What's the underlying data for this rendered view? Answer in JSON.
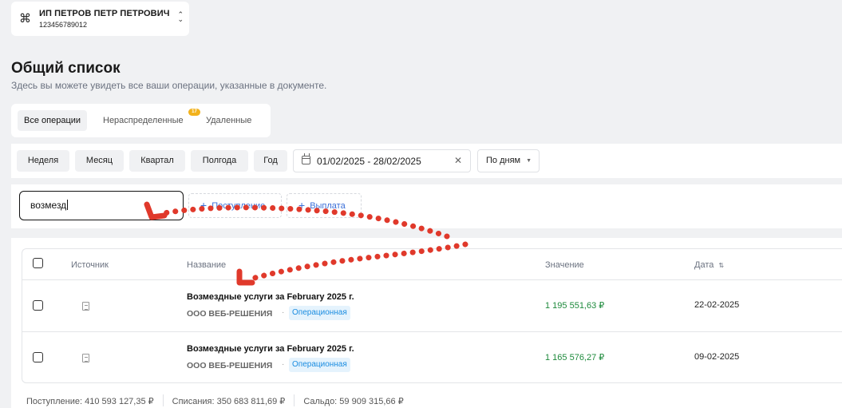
{
  "org": {
    "icon": "command-icon",
    "name": "ИП ПЕТРОВ ПЕТР ПЕТРОВИЧ",
    "inn": "123456789012",
    "switch_icon": "chevron-up-down-icon"
  },
  "page": {
    "title": "Общий список",
    "subtitle": "Здесь вы можете увидеть все ваши операции, указанные в документе."
  },
  "tabs": [
    {
      "label": "Все операции",
      "active": true
    },
    {
      "label": "Нераспределенные",
      "active": false,
      "badge": "17"
    },
    {
      "label": "Удаленные",
      "active": false
    }
  ],
  "filters": {
    "periods": [
      "Неделя",
      "Месяц",
      "Квартал",
      "Полгода",
      "Год"
    ],
    "date_range": "01/02/2025 - 28/02/2025",
    "clear_icon": "close-icon",
    "calendar_icon": "calendar-icon",
    "grouping": "По дням"
  },
  "search": {
    "value": "возмезд",
    "add_income_label": "Поступление",
    "add_payment_label": "Выплата"
  },
  "table": {
    "columns": {
      "source": "Источник",
      "name": "Название",
      "value": "Значение",
      "date": "Дата"
    },
    "rows": [
      {
        "title": "Возмездные услуги за February 2025 г.",
        "org": "ООО ВЕБ-РЕШЕНИЯ",
        "tag": "Операционная",
        "amount": "1 195 551,63 ₽",
        "date": "22-02-2025"
      },
      {
        "title": "Возмездные услуги за February 2025 г.",
        "org": "ООО ВЕБ-РЕШЕНИЯ",
        "tag": "Операционная",
        "amount": "1 165 576,27 ₽",
        "date": "09-02-2025"
      }
    ]
  },
  "totals": {
    "income": "Поступление: 410 593 127,35 ₽",
    "expenses": "Списания: 350 683 811,69 ₽",
    "balance": "Сальдо: 59 909 315,66 ₽"
  },
  "colors": {
    "amount_positive": "#1e8a3c",
    "accent": "#3b6fd8",
    "badge": "#f2b21c",
    "annotation_arrow": "#e0392b"
  }
}
